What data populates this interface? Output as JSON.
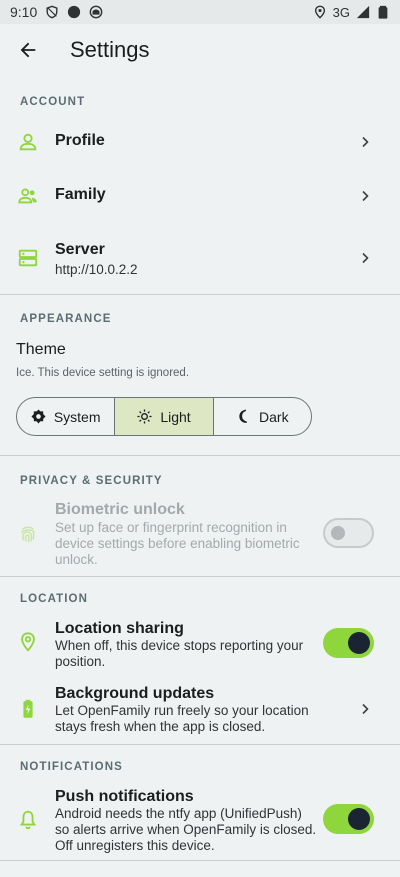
{
  "status_bar": {
    "time": "9:10",
    "network": "3G",
    "icons": [
      "shield-icon",
      "record-icon",
      "vpn-icon",
      "location-pin-icon",
      "signal-icon",
      "battery-icon"
    ]
  },
  "app_bar": {
    "title": "Settings",
    "back_icon": "arrow-back-icon"
  },
  "account": {
    "header": "ACCOUNT",
    "items": [
      {
        "title": "Profile",
        "subtitle": "",
        "icon": "person-icon"
      },
      {
        "title": "Family",
        "subtitle": "",
        "icon": "group-icon"
      },
      {
        "title": "Server",
        "subtitle": "http://10.0.2.2",
        "icon": "server-icon"
      }
    ]
  },
  "appearance": {
    "header": "APPEARANCE",
    "theme_label": "Theme",
    "theme_note": "Ice. This device setting is ignored.",
    "options": [
      "System",
      "Light",
      "Dark"
    ],
    "selected": "Light"
  },
  "privacy": {
    "header": "PRIVACY & SECURITY",
    "biometric": {
      "title": "Biometric unlock",
      "subtitle": "Set up face or fingerprint recognition in device settings before enabling biometric unlock.",
      "enabled": false,
      "disabled": true
    }
  },
  "location": {
    "header": "LOCATION",
    "sharing": {
      "title": "Location sharing",
      "subtitle": "When off, this device stops reporting your position.",
      "enabled": true
    },
    "background": {
      "title": "Background updates",
      "subtitle": "Let OpenFamily run freely so your location stays fresh when the app is closed."
    }
  },
  "notifications": {
    "header": "NOTIFICATIONS",
    "push": {
      "title": "Push notifications",
      "subtitle": "Android needs the ntfy app (UnifiedPush) so alerts arrive when OpenFamily is closed. Off unregisters this device.",
      "enabled": true
    }
  },
  "colors": {
    "accent": "#8ed63b",
    "background": "#eff2f3",
    "selected_segment": "#dde7c4",
    "section_header": "#5c6d72"
  }
}
